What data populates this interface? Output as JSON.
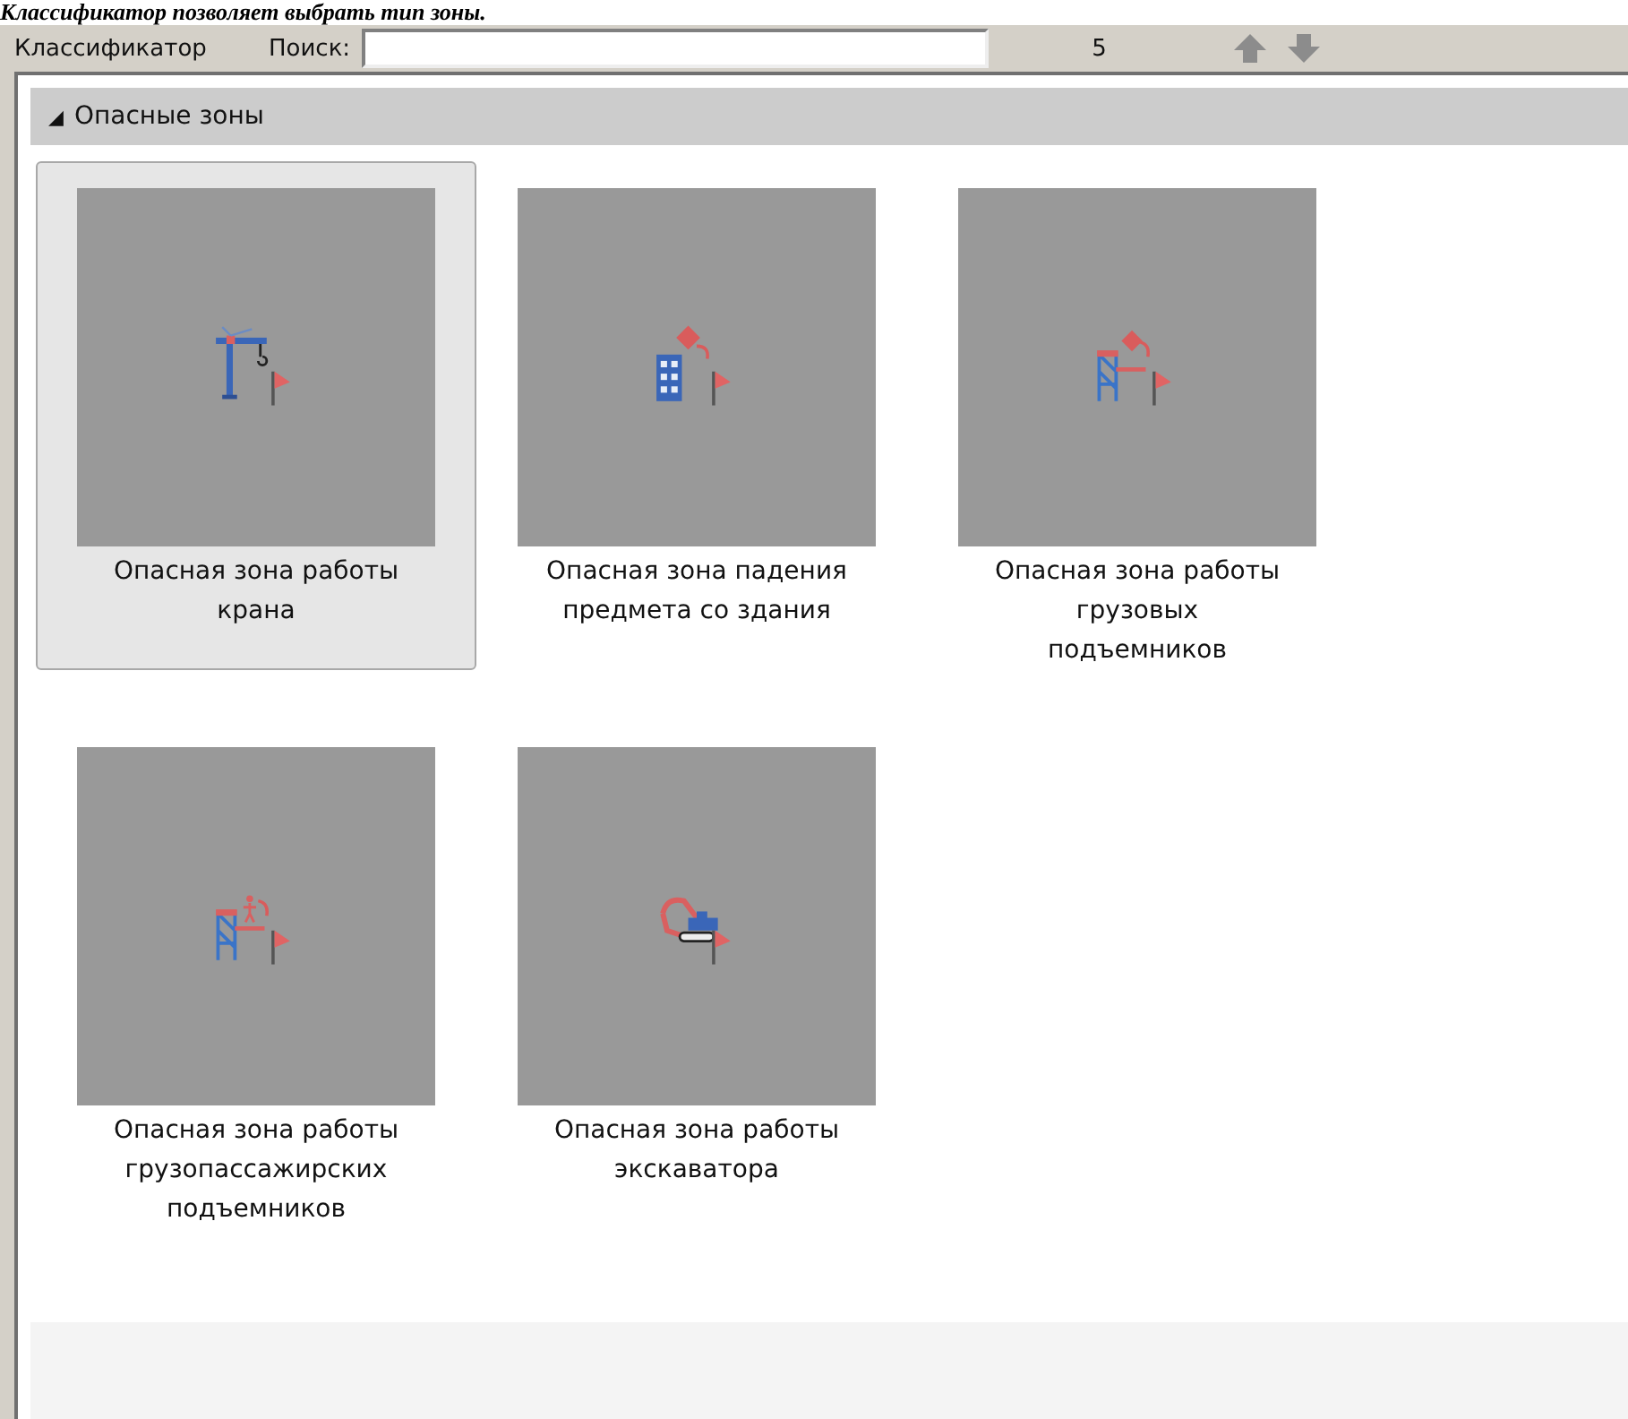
{
  "caption": "Классификатор позволяет выбрать тип зоны.",
  "toolbar": {
    "title": "Классификатор",
    "search_label": "Поиск:",
    "count": "5"
  },
  "group": {
    "title": "Опасные зоны",
    "expanded_glyph": "◢",
    "expanded": true,
    "items": [
      {
        "kind": "crane",
        "label_lines": [
          "Опасная зона работы",
          "крана"
        ],
        "selected": true
      },
      {
        "kind": "building",
        "label_lines": [
          "Опасная зона падения",
          "предмета со здания"
        ],
        "selected": false
      },
      {
        "kind": "hoist",
        "label_lines": [
          "Опасная зона работы",
          "грузовых",
          "подъемников"
        ],
        "selected": false
      },
      {
        "kind": "passenger_hoist",
        "label_lines": [
          "Опасная зона работы",
          "грузопассажирских",
          "подъемников"
        ],
        "selected": false
      },
      {
        "kind": "excavator",
        "label_lines": [
          "Опасная зона работы",
          "экскаватора"
        ],
        "selected": false
      }
    ]
  }
}
